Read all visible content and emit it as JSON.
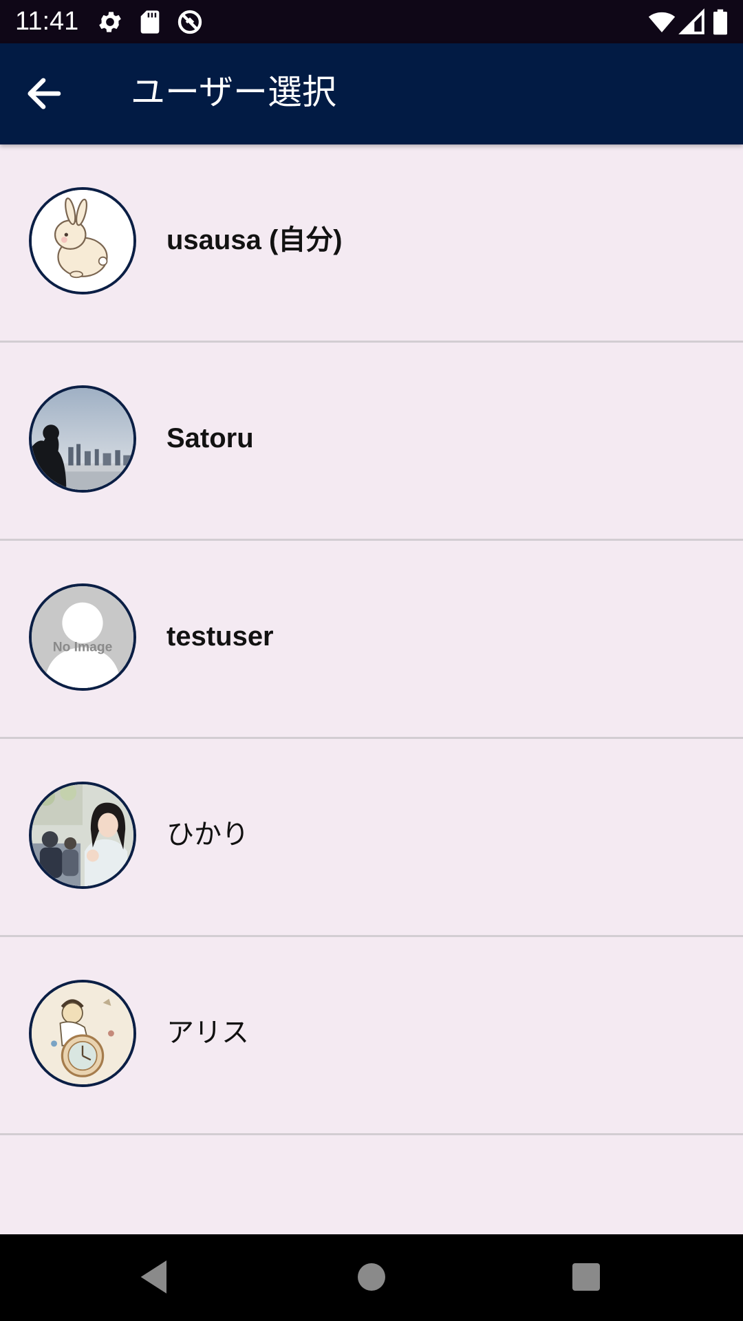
{
  "status_bar": {
    "time": "11:41",
    "icons": [
      "gear-icon",
      "sd-card-icon",
      "data-saver-icon",
      "wifi-icon",
      "signal-icon",
      "battery-icon"
    ]
  },
  "app_bar": {
    "title": "ユーザー選択",
    "back_icon": "arrow-back-icon",
    "background": "#021b44"
  },
  "users": [
    {
      "name": "usausa (自分)",
      "avatar": "rabbit-illustration"
    },
    {
      "name": "Satoru",
      "avatar": "silhouette-city-photo"
    },
    {
      "name": "testuser",
      "avatar": "no-image-placeholder",
      "avatar_text": "No Image"
    },
    {
      "name": "ひかり",
      "avatar": "woman-cafe-photo"
    },
    {
      "name": "アリス",
      "avatar": "alice-clock-illustration"
    }
  ],
  "nav_bar": {
    "buttons": [
      "back-triangle-icon",
      "home-circle-icon",
      "recents-square-icon"
    ]
  },
  "colors": {
    "status_bar": "#0f0717",
    "list_background": "#f4eaf2",
    "divider": "#d2cdd2",
    "avatar_border": "#0b1f45"
  }
}
